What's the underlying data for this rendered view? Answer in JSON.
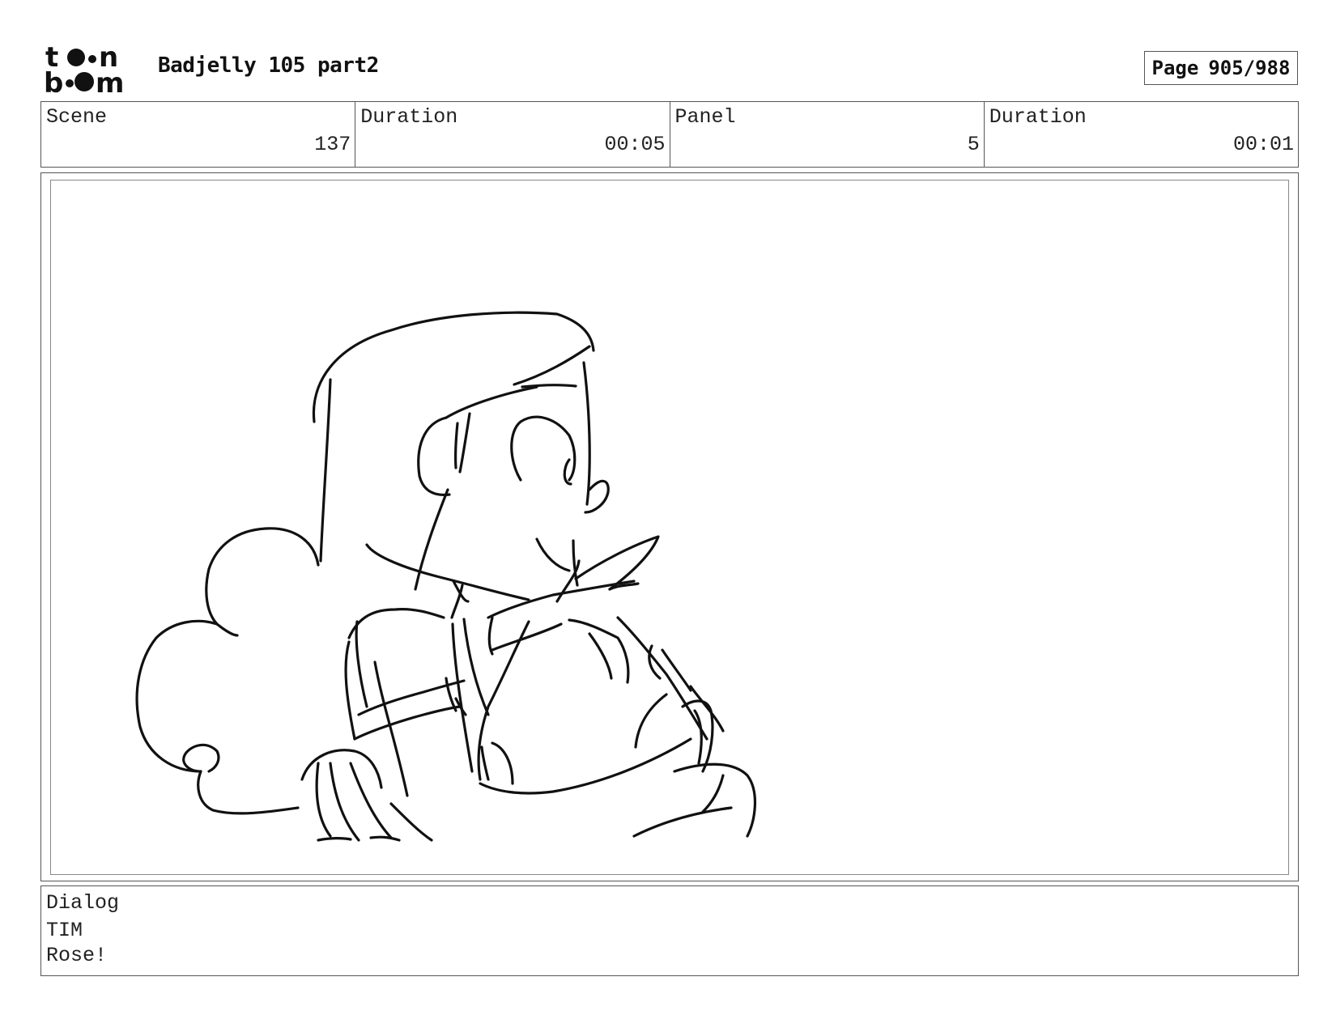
{
  "header": {
    "logo_text": "toon boom",
    "title": "Badjelly 105 part2",
    "page_label": "Page",
    "page_number": "905/988"
  },
  "info": {
    "scene_label": "Scene",
    "scene_value": "137",
    "scene_duration_label": "Duration",
    "scene_duration_value": "00:05",
    "panel_label": "Panel",
    "panel_value": "5",
    "panel_duration_label": "Duration",
    "panel_duration_value": "00:01"
  },
  "panel": {
    "image_description": "rough storyboard sketch"
  },
  "dialog": {
    "label": "Dialog",
    "speaker": "TIM",
    "line": "Rose!"
  }
}
